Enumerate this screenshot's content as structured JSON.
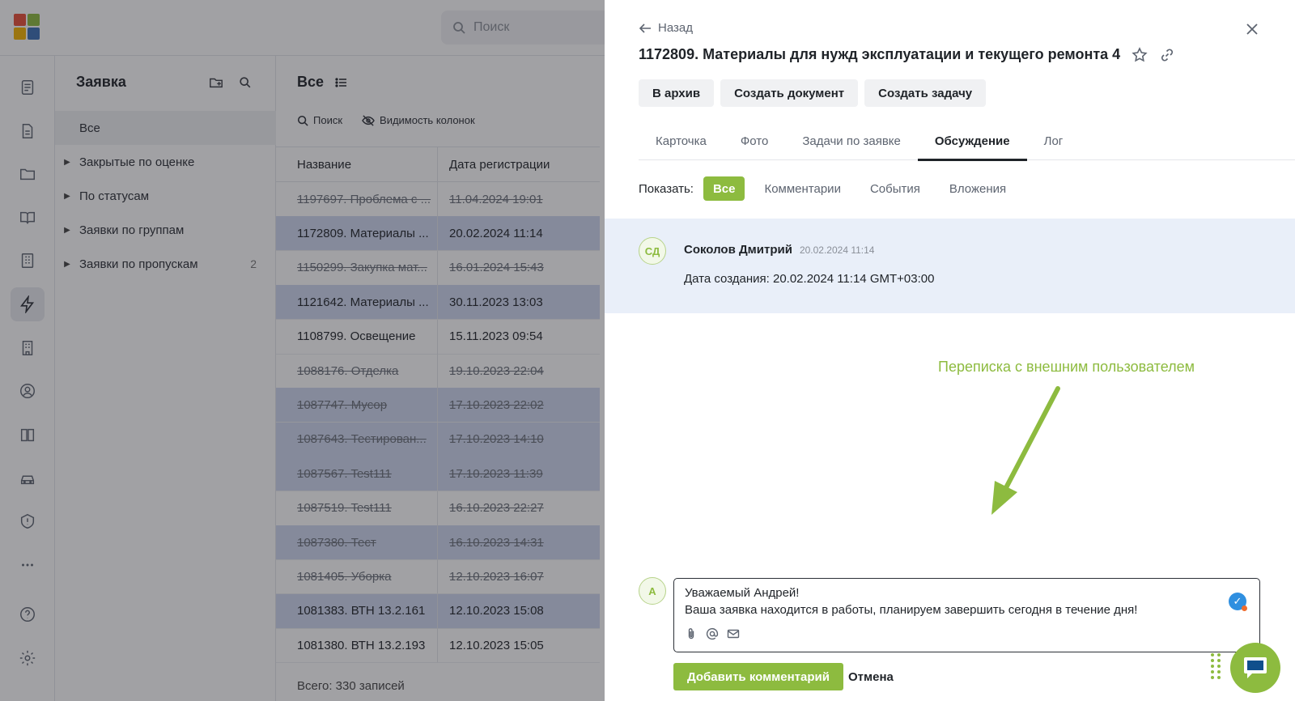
{
  "topbar": {
    "search_placeholder": "Поиск",
    "logo_colors": [
      "#e94f37",
      "#8dbb3f",
      "#f4b400",
      "#3b6fb6"
    ]
  },
  "rail": {
    "icons": [
      "document-icon",
      "file-icon",
      "folder-icon",
      "book-open-icon",
      "building-list-icon",
      "lightning-icon",
      "office-building-icon",
      "user-circle-icon",
      "book-icon",
      "car-icon",
      "shield-alert-icon",
      "more-icon",
      "help-icon",
      "gear-icon"
    ],
    "active": "lightning-icon"
  },
  "tree": {
    "title": "Заявка",
    "items": [
      {
        "label": "Все",
        "count": ""
      },
      {
        "label": "Закрытые по оценке",
        "count": ""
      },
      {
        "label": "По статусам",
        "count": ""
      },
      {
        "label": "Заявки по группам",
        "count": ""
      },
      {
        "label": "Заявки по пропускам",
        "count": "2"
      }
    ]
  },
  "list": {
    "title": "Все",
    "search_label": "Поиск",
    "columns_label": "Видимость колонок",
    "headers": [
      "Название",
      "Дата регистрации"
    ],
    "rows": [
      {
        "name": "1197697. Проблема с ...",
        "date": "11.04.2024 19:01",
        "style": "strike"
      },
      {
        "name": "1172809. Материалы ...",
        "date": "20.02.2024 11:14",
        "style": "hl"
      },
      {
        "name": "1150299. Закупка мат...",
        "date": "16.01.2024 15:43",
        "style": "strike"
      },
      {
        "name": "1121642. Материалы ...",
        "date": "30.11.2023 13:03",
        "style": "hl"
      },
      {
        "name": "1108799. Освещение",
        "date": "15.11.2023 09:54",
        "style": ""
      },
      {
        "name": "1088176. Отделка",
        "date": "19.10.2023 22:04",
        "style": "strike"
      },
      {
        "name": "1087747. Мусор",
        "date": "17.10.2023 22:02",
        "style": "hl strike"
      },
      {
        "name": "1087643. Тестирован...",
        "date": "17.10.2023 14:10",
        "style": "hl strike"
      },
      {
        "name": "1087567. Test111",
        "date": "17.10.2023 11:39",
        "style": "hl strike"
      },
      {
        "name": "1087519. Test111",
        "date": "16.10.2023 22:27",
        "style": "strike"
      },
      {
        "name": "1087380. Тест",
        "date": "16.10.2023 14:31",
        "style": "hl strike"
      },
      {
        "name": "1081405. Уборка",
        "date": "12.10.2023 16:07",
        "style": "strike"
      },
      {
        "name": "1081383. ВТН 13.2.161",
        "date": "12.10.2023 15:08",
        "style": "hl"
      },
      {
        "name": "1081380. ВТН 13.2.193",
        "date": "12.10.2023 15:05",
        "style": ""
      }
    ],
    "footer": "Всего: 330 записей"
  },
  "drawer": {
    "back_label": "Назад",
    "title": "1172809. Материалы для нужд эксплуатации и текущего ремонта 4",
    "actions": [
      "В архив",
      "Создать документ",
      "Создать задачу"
    ],
    "tabs": [
      {
        "label": "Карточка",
        "active": false
      },
      {
        "label": "Фото",
        "active": false
      },
      {
        "label": "Задачи по заявке",
        "active": false
      },
      {
        "label": "Обсуждение",
        "active": true
      },
      {
        "label": "Лог",
        "active": false
      }
    ],
    "filter_label": "Показать:",
    "filters": [
      {
        "label": "Все",
        "active": true
      },
      {
        "label": "Комментарии",
        "active": false
      },
      {
        "label": "События",
        "active": false
      },
      {
        "label": "Вложения",
        "active": false
      }
    ],
    "event": {
      "avatar": "СД",
      "author": "Соколов Дмитрий",
      "time": "20.02.2024 11:14",
      "text": "Дата создания: 20.02.2024 11:14 GMT+03:00"
    },
    "annotation": "Переписка с внешним пользователем",
    "composer": {
      "avatar": "А",
      "line1": "Уважаемый Андрей!",
      "line2": "Ваша заявка находится в работы, планируем завершить сегодня в течение дня!",
      "submit_label": "Добавить комментарий",
      "cancel_label": "Отмена"
    },
    "accent_color": "#8dbb3f"
  }
}
